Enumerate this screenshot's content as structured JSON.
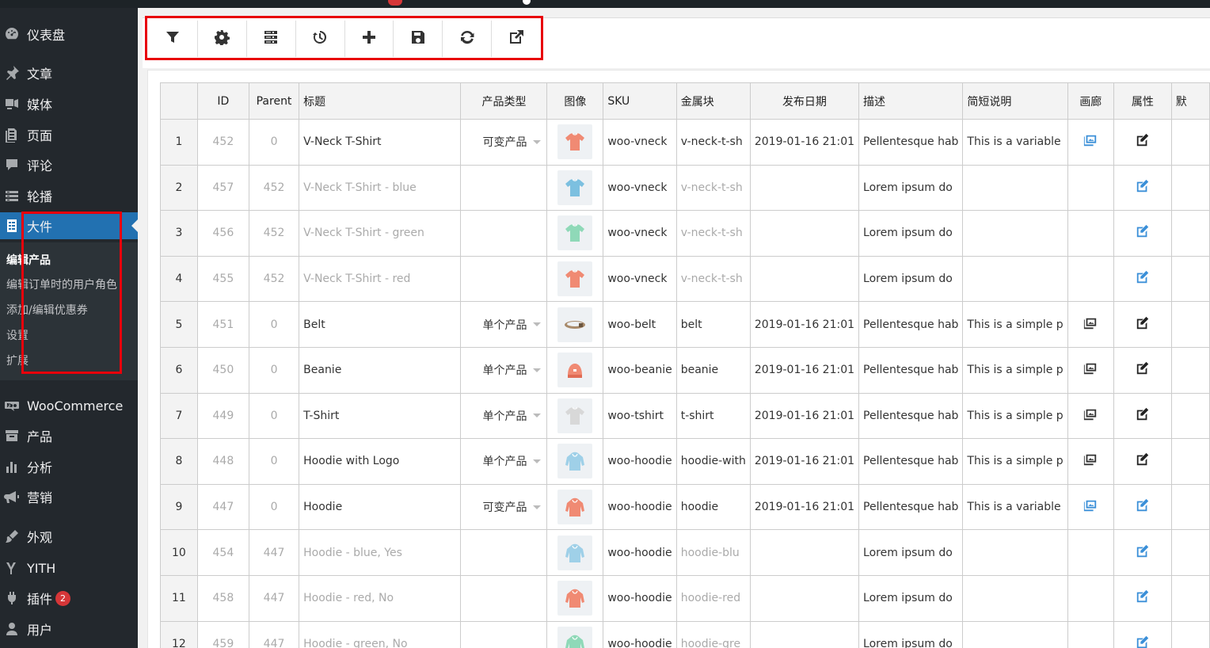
{
  "sidebar": {
    "items": [
      {
        "label": "仪表盘",
        "icon": "dashboard-icon"
      },
      {
        "label": "文章",
        "icon": "pin-icon"
      },
      {
        "label": "媒体",
        "icon": "media-icon"
      },
      {
        "label": "页面",
        "icon": "page-icon"
      },
      {
        "label": "评论",
        "icon": "comment-icon"
      },
      {
        "label": "轮播",
        "icon": "slider-icon"
      },
      {
        "label": "大件",
        "icon": "document-icon",
        "active": true
      },
      {
        "label": "WooCommerce",
        "icon": "woo-icon"
      },
      {
        "label": "产品",
        "icon": "archive-icon"
      },
      {
        "label": "分析",
        "icon": "bar-chart-icon"
      },
      {
        "label": "营销",
        "icon": "megaphone-icon"
      },
      {
        "label": "外观",
        "icon": "brush-icon"
      },
      {
        "label": "YITH",
        "icon": "yith-icon"
      },
      {
        "label": "插件",
        "icon": "plugin-icon",
        "badge": "2"
      },
      {
        "label": "用户",
        "icon": "user-icon"
      }
    ],
    "submenu": [
      {
        "label": "编辑产品",
        "current": true
      },
      {
        "label": "编辑订单时的用户角色"
      },
      {
        "label": "添加/编辑优惠券"
      },
      {
        "label": "设置"
      },
      {
        "label": "扩展"
      }
    ]
  },
  "toolbar": {
    "buttons": [
      {
        "name": "filter-button",
        "icon": "filter-icon"
      },
      {
        "name": "settings-button",
        "icon": "gear-icon"
      },
      {
        "name": "columns-button",
        "icon": "server-icon"
      },
      {
        "name": "history-button",
        "icon": "history-icon"
      },
      {
        "name": "add-button",
        "icon": "plus-icon"
      },
      {
        "name": "save-button",
        "icon": "save-icon"
      },
      {
        "name": "refresh-button",
        "icon": "refresh-icon"
      },
      {
        "name": "external-edit-button",
        "icon": "external-link-icon"
      }
    ]
  },
  "table": {
    "columns": [
      "",
      "ID",
      "Parent",
      "标题",
      "产品类型",
      "图像",
      "SKU",
      "金属块",
      "发布日期",
      "描述",
      "简短说明",
      "画廊",
      "属性",
      "默"
    ],
    "rows": [
      {
        "n": "1",
        "id": "452",
        "parent": "0",
        "title": "V-Neck T-Shirt",
        "type": "可变产品",
        "img": "vneck",
        "color": "#f08a73",
        "sku": "woo-vneck",
        "slug": "v-neck-t-sh",
        "date": "2019-01-16 21:01",
        "desc": "Pellentesque hab",
        "short": "This is a variable",
        "gallery": "blue",
        "attr": "dark",
        "variation": false
      },
      {
        "n": "2",
        "id": "457",
        "parent": "452",
        "title": "V-Neck T-Shirt - blue",
        "type": "",
        "img": "vneck",
        "color": "#7cc0e0",
        "sku": "woo-vneck",
        "slug": "v-neck-t-sh",
        "date": "",
        "desc": "Lorem ipsum do",
        "short": "",
        "gallery": "",
        "attr": "blue",
        "variation": true
      },
      {
        "n": "3",
        "id": "456",
        "parent": "452",
        "title": "V-Neck T-Shirt - green",
        "type": "",
        "img": "vneck",
        "color": "#8fd9b8",
        "sku": "woo-vneck",
        "slug": "v-neck-t-sh",
        "date": "",
        "desc": "Lorem ipsum do",
        "short": "",
        "gallery": "",
        "attr": "blue",
        "variation": true
      },
      {
        "n": "4",
        "id": "455",
        "parent": "452",
        "title": "V-Neck T-Shirt - red",
        "type": "",
        "img": "vneck",
        "color": "#f08a73",
        "sku": "woo-vneck",
        "slug": "v-neck-t-sh",
        "date": "",
        "desc": "Lorem ipsum do",
        "short": "",
        "gallery": "",
        "attr": "blue",
        "variation": true
      },
      {
        "n": "5",
        "id": "451",
        "parent": "0",
        "title": "Belt",
        "type": "单个产品",
        "img": "belt",
        "color": "#a88a6a",
        "sku": "woo-belt",
        "slug": "belt",
        "date": "2019-01-16 21:01",
        "desc": "Pellentesque hab",
        "short": "This is a simple p",
        "gallery": "dark",
        "attr": "dark",
        "variation": false
      },
      {
        "n": "6",
        "id": "450",
        "parent": "0",
        "title": "Beanie",
        "type": "单个产品",
        "img": "beanie",
        "color": "#f08a73",
        "sku": "woo-beanie",
        "slug": "beanie",
        "date": "2019-01-16 21:01",
        "desc": "Pellentesque hab",
        "short": "This is a simple p",
        "gallery": "dark",
        "attr": "dark",
        "variation": false
      },
      {
        "n": "7",
        "id": "449",
        "parent": "0",
        "title": "T-Shirt",
        "type": "单个产品",
        "img": "tshirt",
        "color": "#d8d8d8",
        "sku": "woo-tshirt",
        "slug": "t-shirt",
        "date": "2019-01-16 21:01",
        "desc": "Pellentesque hab",
        "short": "This is a simple p",
        "gallery": "dark",
        "attr": "dark",
        "variation": false
      },
      {
        "n": "8",
        "id": "448",
        "parent": "0",
        "title": "Hoodie with Logo",
        "type": "单个产品",
        "img": "hoodie",
        "color": "#9fd0e8",
        "sku": "woo-hoodie",
        "slug": "hoodie-with",
        "date": "2019-01-16 21:01",
        "desc": "Pellentesque hab",
        "short": "This is a simple p",
        "gallery": "dark",
        "attr": "dark",
        "variation": false
      },
      {
        "n": "9",
        "id": "447",
        "parent": "0",
        "title": "Hoodie",
        "type": "可变产品",
        "img": "hoodie",
        "color": "#f08a73",
        "sku": "woo-hoodie",
        "slug": "hoodie",
        "date": "2019-01-16 21:01",
        "desc": "Pellentesque hab",
        "short": "This is a variable",
        "gallery": "blue",
        "attr": "blue",
        "variation": false
      },
      {
        "n": "10",
        "id": "454",
        "parent": "447",
        "title": "Hoodie - blue, Yes",
        "type": "",
        "img": "hoodie",
        "color": "#9fd0e8",
        "sku": "woo-hoodie",
        "slug": "hoodie-blu",
        "date": "",
        "desc": "Lorem ipsum do",
        "short": "",
        "gallery": "",
        "attr": "blue",
        "variation": true
      },
      {
        "n": "11",
        "id": "458",
        "parent": "447",
        "title": "Hoodie - red, No",
        "type": "",
        "img": "hoodie",
        "color": "#f08a73",
        "sku": "woo-hoodie",
        "slug": "hoodie-red",
        "date": "",
        "desc": "Lorem ipsum do",
        "short": "",
        "gallery": "",
        "attr": "blue",
        "variation": true
      },
      {
        "n": "12",
        "id": "459",
        "parent": "447",
        "title": "Hoodie - green, No",
        "type": "",
        "img": "hoodie",
        "color": "#8fd9b8",
        "sku": "woo-hoodie",
        "slug": "hoodie-gre",
        "date": "",
        "desc": "Lorem ipsum do",
        "short": "",
        "gallery": "",
        "attr": "blue",
        "variation": true
      }
    ]
  }
}
